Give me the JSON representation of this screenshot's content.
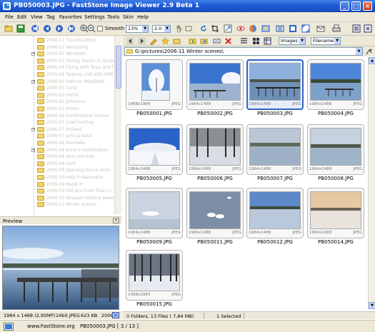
{
  "window": {
    "title": "PB050003.JPG - FastStone Image Viewer 2.9 Beta 1"
  },
  "menu": [
    "File",
    "Edit",
    "View",
    "Tag",
    "Favorites",
    "Settings",
    "Tools",
    "Skin",
    "Help"
  ],
  "toolbar": {
    "smooth_label": "Smooth",
    "zoom_value": "13%",
    "gamma_value": "2.0"
  },
  "folder_tree": [
    "2006-11 Travelbuilding",
    "2006-12 Verhuizing",
    "2006-02 Wombats",
    "2006-03 Diving, Easter & Gradu",
    "2006-04 Flying with Tasja and f",
    "2006-04 Tanjong visit with AME",
    "2006-05 Helsinki Metsäkoti",
    "2006-05 Corte",
    "2006-05 Herfst",
    "2006-05 Johannus",
    "2006-05 Simon",
    "2006-06 Confirmation Dinner",
    "2006-07 Crab hunting",
    "2006-07 Holland",
    "2006-07 Juho ja kulut",
    "2006-08 Munnelle",
    "2006-08 Anna's confirmation",
    "2006-08 dive cult trak",
    "2006-08 Lord",
    "2006-08 Opening dance recor",
    "2006-09 Hats in Nanurativ",
    "2006-09 Mudd ®",
    "2006-09 Old pics from Tina's c",
    "2006-10 Tarquaz trekking weeks",
    "2006-11 Winter scenes"
  ],
  "preview": {
    "header": "Preview",
    "resolution": "1984 x 1488 (2,95MP)",
    "bit_depth": "24bit JPEG",
    "file_size": "623 KB",
    "date_partial": "2006"
  },
  "browser": {
    "view_mode": "Images",
    "sort_by": "Filename",
    "path": "G:\\pictures\\2006-11 Winter scenes\\"
  },
  "thumbnails": [
    {
      "filename": "PB050001.JPG",
      "dims": "1488x1984",
      "format": "JPEG",
      "selected": false
    },
    {
      "filename": "PB050002.JPG",
      "dims": "1984x1488",
      "format": "JPEG",
      "selected": false
    },
    {
      "filename": "PB050003.JPG",
      "dims": "1984x1488",
      "format": "JPEG",
      "selected": true
    },
    {
      "filename": "PB050004.JPG",
      "dims": "1984x1488",
      "format": "JPEG",
      "selected": false
    },
    {
      "filename": "PB050005.JPG",
      "dims": "1984x1488",
      "format": "JPEG",
      "selected": false
    },
    {
      "filename": "PB050006.JPG",
      "dims": "1984x1488",
      "format": "JPEG",
      "selected": false
    },
    {
      "filename": "PB050007.JPG",
      "dims": "1984x1488",
      "format": "JPEG",
      "selected": false
    },
    {
      "filename": "PB050008.JPG",
      "dims": "1984x1488",
      "format": "JPEG",
      "selected": false
    },
    {
      "filename": "PB050009.JPG",
      "dims": "1984x1488",
      "format": "JPEG",
      "selected": false
    },
    {
      "filename": "PB050011.JPG",
      "dims": "1984x1488",
      "format": "JPEG",
      "selected": false
    },
    {
      "filename": "PB050012.JPG",
      "dims": "1984x1488",
      "format": "JPEG",
      "selected": false
    },
    {
      "filename": "PB050014.JPG",
      "dims": "1984x1488",
      "format": "JPEG",
      "selected": false
    },
    {
      "filename": "PB050015.JPG",
      "dims": "1488x1984",
      "format": "JPEG",
      "selected": false
    }
  ],
  "status": {
    "folder_counts": "0 Folders, 13 Files ( 7,84 MB)",
    "selection": "1 Selected",
    "website": "www.FastStone.org",
    "current_file": "PB050003.JPG [ 3 / 13 ]"
  },
  "colors": {
    "title_bar": "#1b57d4",
    "selection": "#3163c6",
    "chrome": "#ece9d8"
  }
}
